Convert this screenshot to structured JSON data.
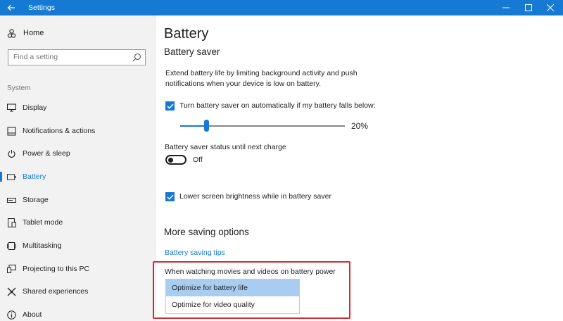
{
  "window": {
    "title": "Settings",
    "titlebar_color": "#1679d4",
    "controls": [
      "minimize-icon",
      "maximize-icon",
      "close-icon"
    ]
  },
  "sidebar": {
    "home_label": "Home",
    "search_placeholder": "Find a setting",
    "section_label": "System",
    "items": [
      {
        "label": "Display",
        "icon": "display-icon"
      },
      {
        "label": "Notifications & actions",
        "icon": "notifications-icon"
      },
      {
        "label": "Power & sleep",
        "icon": "power-icon"
      },
      {
        "label": "Battery",
        "icon": "battery-icon",
        "active": true
      },
      {
        "label": "Storage",
        "icon": "storage-icon"
      },
      {
        "label": "Tablet mode",
        "icon": "tablet-icon"
      },
      {
        "label": "Multitasking",
        "icon": "multitasking-icon"
      },
      {
        "label": "Projecting to this PC",
        "icon": "projecting-icon"
      },
      {
        "label": "Shared experiences",
        "icon": "shared-experiences-icon"
      },
      {
        "label": "About",
        "icon": "about-icon"
      }
    ]
  },
  "main": {
    "title": "Battery",
    "battery_saver": {
      "heading": "Battery saver",
      "description": "Extend battery life by limiting background activity and push notifications when your device is low on battery.",
      "auto_checkbox_label": "Turn battery saver on automatically if my battery falls below:",
      "auto_checked": true,
      "threshold_percent": 20,
      "threshold_label": "20%",
      "status_label": "Battery saver status until next charge",
      "status_toggle_label": "Off",
      "brightness_checkbox_label": "Lower screen brightness while in battery saver",
      "brightness_checked": true
    },
    "more_options": {
      "heading": "More saving options",
      "tips_link": "Battery saving tips",
      "video_label": "When watching movies and videos on battery power",
      "video_options": [
        "Optimize for battery life",
        "Optimize for video quality"
      ],
      "video_selected": "Optimize for battery life"
    }
  },
  "colors": {
    "accent": "#1679d4",
    "highlight_border": "#d12d35",
    "selected_option": "#a8cdf0"
  }
}
